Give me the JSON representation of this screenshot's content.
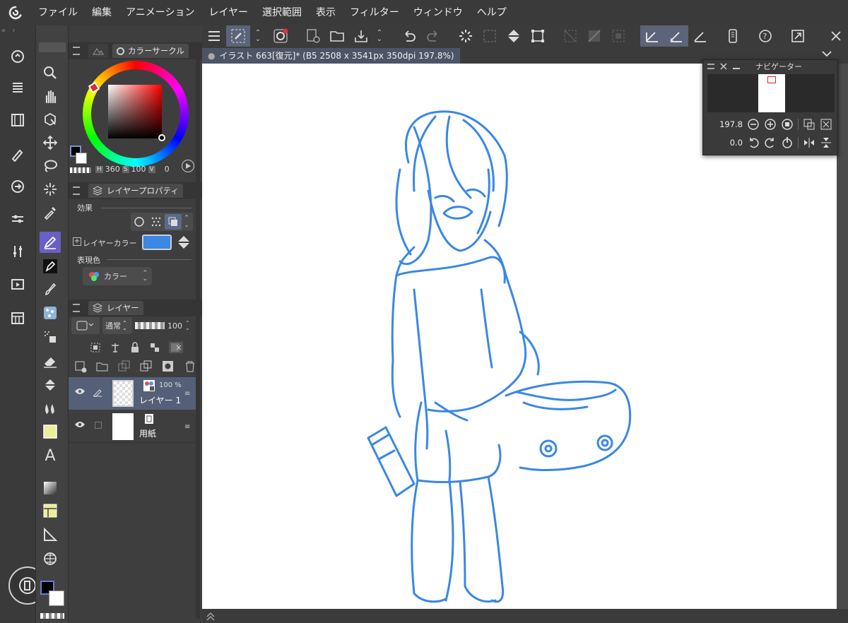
{
  "menu": [
    "ファイル",
    "編集",
    "アニメーション",
    "レイヤー",
    "選択範囲",
    "表示",
    "フィルター",
    "ウィンドウ",
    "ヘルプ"
  ],
  "strip_icons": [
    "home-icon",
    "list-icon",
    "film-icon",
    "layer-edit-icon",
    "swap-icon",
    "sliders-icon",
    "adjust-icon",
    "timeline-icon",
    "grid-panel-icon"
  ],
  "tools": [
    "zoom-icon",
    "hand-icon",
    "object-select-icon",
    "move-icon",
    "lasso-icon",
    "magic-wand-icon",
    "eyedropper-icon",
    "pen-icon",
    "ink-pen-icon",
    "brush-icon",
    "texture-brush-icon",
    "airbrush-icon",
    "eraser-icon",
    "fill-bucket-icon",
    "blend-icon",
    "shape-square-icon",
    "text-icon",
    "gradient-icon",
    "frame-icon",
    "ruler-icon",
    "grid-icon"
  ],
  "color_panel": {
    "title": "カラーサークル",
    "h_label": "H",
    "h_value": "360",
    "s_label": "S",
    "s_value": "100",
    "v_label": "V",
    "v_value": "0"
  },
  "layer_property": {
    "title": "レイヤープロパティ",
    "effect_label": "効果",
    "layer_color_label": "レイヤーカラー",
    "layer_color": "#3a87e6",
    "expression_label": "表現色",
    "expression_value": "カラー"
  },
  "layers": {
    "title": "レイヤー",
    "blend_mode": "通常",
    "opacity": "100",
    "items": [
      {
        "name": "レイヤー 1",
        "opacity": "100 %",
        "selected": true
      },
      {
        "name": "用紙",
        "opacity": "",
        "selected": false
      }
    ]
  },
  "document": {
    "tab_title": "イラスト 663[復元]* (B5 2508 x 3541px 350dpi 197.8%)"
  },
  "navigator": {
    "title": "ナビゲーター",
    "zoom": "197.8",
    "rotation": "0.0"
  },
  "colors": {
    "accent": "#6a5fc6",
    "sketch_blue": "#3a87e6",
    "panel_bg": "#3e3e3e"
  }
}
